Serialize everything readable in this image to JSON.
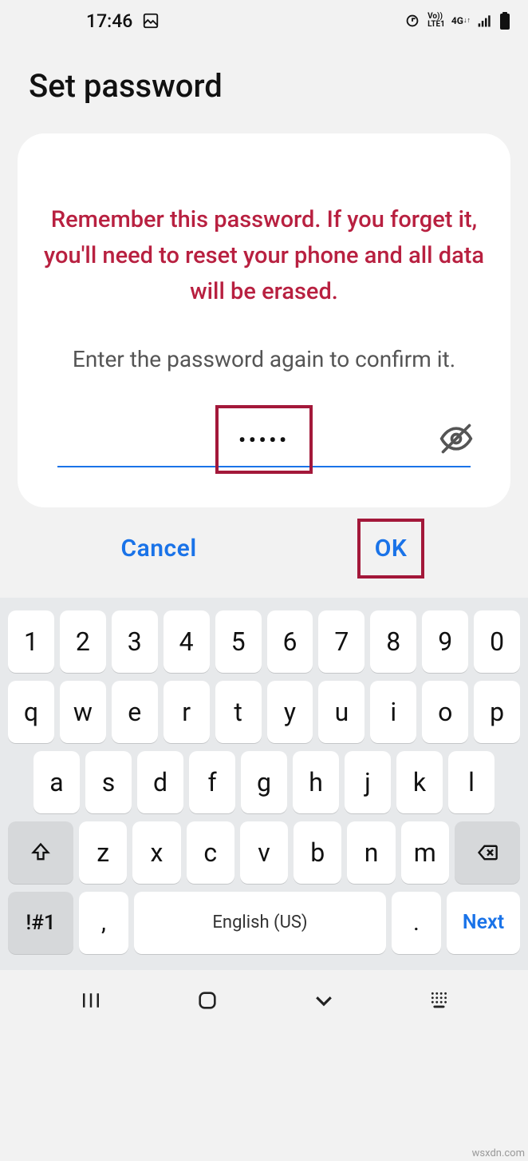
{
  "status": {
    "time": "17:46"
  },
  "page": {
    "title": "Set password"
  },
  "card": {
    "warning": "Remember this password. If you forget it, you'll need to reset your phone and all data will be erased.",
    "instruction": "Enter the password again to confirm it.",
    "password_mask": "•••••"
  },
  "buttons": {
    "cancel": "Cancel",
    "ok": "OK"
  },
  "keyboard": {
    "row1": [
      "1",
      "2",
      "3",
      "4",
      "5",
      "6",
      "7",
      "8",
      "9",
      "0"
    ],
    "row2": [
      "q",
      "w",
      "e",
      "r",
      "t",
      "y",
      "u",
      "i",
      "o",
      "p"
    ],
    "row3": [
      "a",
      "s",
      "d",
      "f",
      "g",
      "h",
      "j",
      "k",
      "l"
    ],
    "row4": [
      "z",
      "x",
      "c",
      "v",
      "b",
      "n",
      "m"
    ],
    "sym": "!#1",
    "space": "English (US)",
    "next": "Next",
    "comma": ",",
    "period": "."
  },
  "watermark": "wsxdn.com"
}
